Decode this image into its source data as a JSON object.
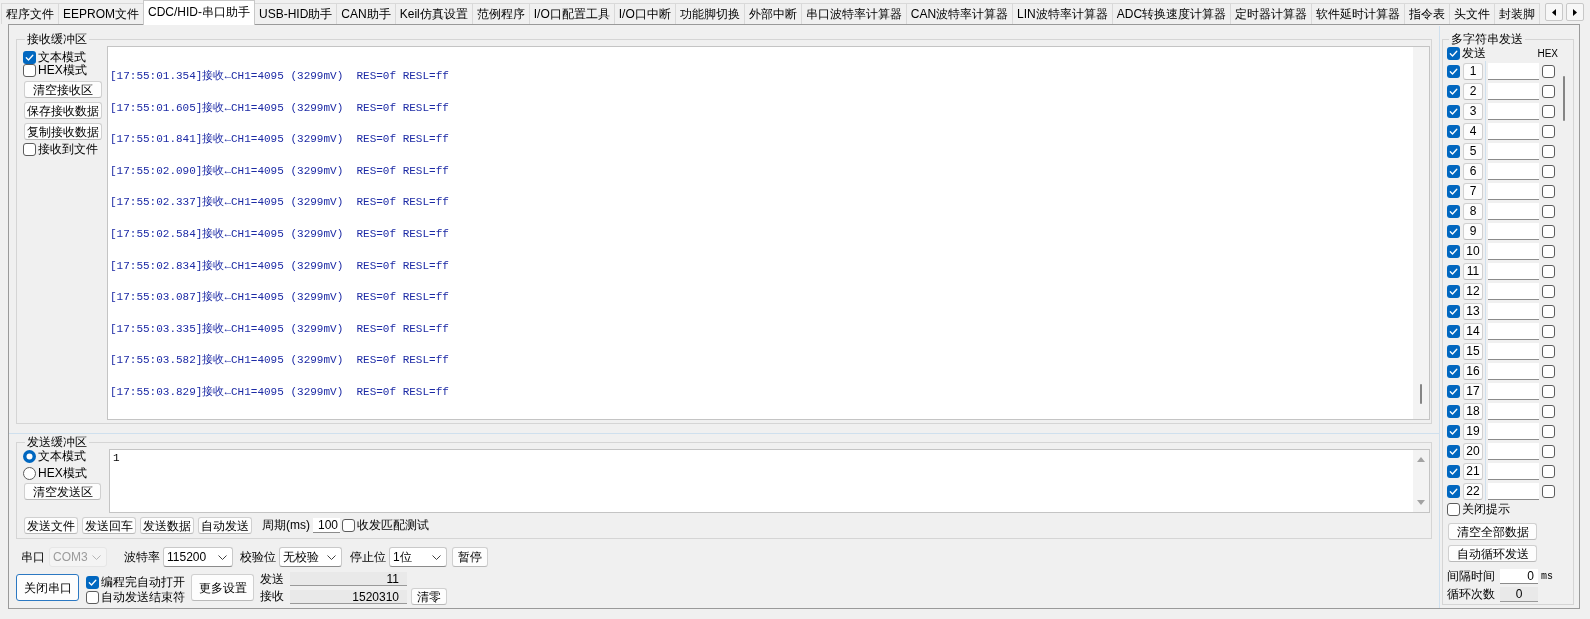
{
  "tabs": [
    {
      "label": "程序文件",
      "selected": false
    },
    {
      "label": "EEPROM文件",
      "selected": false
    },
    {
      "label": "CDC/HID-串口助手",
      "selected": true
    },
    {
      "label": "USB-HID助手",
      "selected": false
    },
    {
      "label": "CAN助手",
      "selected": false
    },
    {
      "label": "Keil仿真设置",
      "selected": false
    },
    {
      "label": "范例程序",
      "selected": false
    },
    {
      "label": "I/O口配置工具",
      "selected": false
    },
    {
      "label": "I/O口中断",
      "selected": false
    },
    {
      "label": "功能脚切换",
      "selected": false
    },
    {
      "label": "外部中断",
      "selected": false
    },
    {
      "label": "串口波特率计算器",
      "selected": false
    },
    {
      "label": "CAN波特率计算器",
      "selected": false
    },
    {
      "label": "LIN波特率计算器",
      "selected": false
    },
    {
      "label": "ADC转换速度计算器",
      "selected": false
    },
    {
      "label": "定时器计算器",
      "selected": false
    },
    {
      "label": "软件延时计算器",
      "selected": false
    },
    {
      "label": "指令表",
      "selected": false
    },
    {
      "label": "头文件",
      "selected": false
    },
    {
      "label": "封装脚",
      "selected": false
    }
  ],
  "receive": {
    "title": "接收缓冲区",
    "options": [
      {
        "kind": "checkbox",
        "label": "文本模式",
        "checked": true
      },
      {
        "kind": "checkbox",
        "label": "HEX模式",
        "checked": false
      },
      {
        "kind": "button",
        "label": "清空接收区"
      },
      {
        "kind": "button",
        "label": "保存接收数据"
      },
      {
        "kind": "button",
        "label": "复制接收数据"
      },
      {
        "kind": "checkbox",
        "label": "接收到文件",
        "checked": false
      }
    ],
    "log": [
      "[17:55:01.354]接收←CH1=4095 (3299mV)  RES=0f RESL=ff",
      "[17:55:01.605]接收←CH1=4095 (3299mV)  RES=0f RESL=ff",
      "[17:55:01.841]接收←CH1=4095 (3299mV)  RES=0f RESL=ff",
      "[17:55:02.090]接收←CH1=4095 (3299mV)  RES=0f RESL=ff",
      "[17:55:02.337]接收←CH1=4095 (3299mV)  RES=0f RESL=ff",
      "[17:55:02.584]接收←CH1=4095 (3299mV)  RES=0f RESL=ff",
      "[17:55:02.834]接收←CH1=4095 (3299mV)  RES=0f RESL=ff",
      "[17:55:03.087]接收←CH1=4095 (3299mV)  RES=0f RESL=ff",
      "[17:55:03.335]接收←CH1=4095 (3299mV)  RES=0f RESL=ff",
      "[17:55:03.582]接收←CH1=4095 (3299mV)  RES=0f RESL=ff",
      "[17:55:03.829]接收←CH1=4095 (3299mV)  RES=0f RESL=ff"
    ]
  },
  "send": {
    "title": "发送缓冲区",
    "modes": [
      {
        "label": "文本模式",
        "selected": true
      },
      {
        "label": "HEX模式",
        "selected": false
      }
    ],
    "clear_button": "清空发送区",
    "value": "1",
    "actions": [
      "发送文件",
      "发送回车",
      "发送数据",
      "自动发送"
    ],
    "period": {
      "label": "周期(ms)",
      "value": "100"
    },
    "match_test": {
      "label": "收发匹配测试",
      "checked": false
    }
  },
  "serial": {
    "selects": [
      {
        "label": "串口",
        "value": "COM3",
        "disabled": true
      },
      {
        "label": "波特率",
        "value": "115200",
        "disabled": false
      },
      {
        "label": "校验位",
        "value": "无校验",
        "disabled": false
      },
      {
        "label": "停止位",
        "value": "1位",
        "disabled": false
      }
    ],
    "pause_button": "暂停",
    "open_button": {
      "label": "关闭串口",
      "focused": true
    },
    "options": [
      {
        "label": "编程完自动打开",
        "checked": true
      },
      {
        "label": "自动发送结束符",
        "checked": false
      }
    ],
    "more_button": "更多设置",
    "counters": [
      {
        "label": "发送",
        "value": "11"
      },
      {
        "label": "接收",
        "value": "1520310"
      }
    ],
    "reset_button": "清零"
  },
  "multi_send": {
    "title": "多字符串发送",
    "send_all": {
      "label": "发送",
      "checked": true
    },
    "hex_header": "HEX",
    "rows": [
      {
        "number": "1",
        "checked": true,
        "hex": false
      },
      {
        "number": "2",
        "checked": true,
        "hex": false
      },
      {
        "number": "3",
        "checked": true,
        "hex": false
      },
      {
        "number": "4",
        "checked": true,
        "hex": false
      },
      {
        "number": "5",
        "checked": true,
        "hex": false
      },
      {
        "number": "6",
        "checked": true,
        "hex": false
      },
      {
        "number": "7",
        "checked": true,
        "hex": false
      },
      {
        "number": "8",
        "checked": true,
        "hex": false
      },
      {
        "number": "9",
        "checked": true,
        "hex": false
      },
      {
        "number": "10",
        "checked": true,
        "hex": false
      },
      {
        "number": "11",
        "checked": true,
        "hex": false
      },
      {
        "number": "12",
        "checked": true,
        "hex": false
      },
      {
        "number": "13",
        "checked": true,
        "hex": false
      },
      {
        "number": "14",
        "checked": true,
        "hex": false
      },
      {
        "number": "15",
        "checked": true,
        "hex": false
      },
      {
        "number": "16",
        "checked": true,
        "hex": false
      },
      {
        "number": "17",
        "checked": true,
        "hex": false
      },
      {
        "number": "18",
        "checked": true,
        "hex": false
      },
      {
        "number": "19",
        "checked": true,
        "hex": false
      },
      {
        "number": "20",
        "checked": true,
        "hex": false
      },
      {
        "number": "21",
        "checked": true,
        "hex": false
      },
      {
        "number": "22",
        "checked": true,
        "hex": false
      }
    ],
    "close_hint": {
      "label": "关闭提示",
      "checked": false
    },
    "buttons": [
      "清空全部数据",
      "自动循环发送"
    ],
    "interval": {
      "label": "间隔时间",
      "value": "0",
      "unit": "ms"
    },
    "loop_count": {
      "label": "循环次数",
      "value": "0"
    }
  }
}
